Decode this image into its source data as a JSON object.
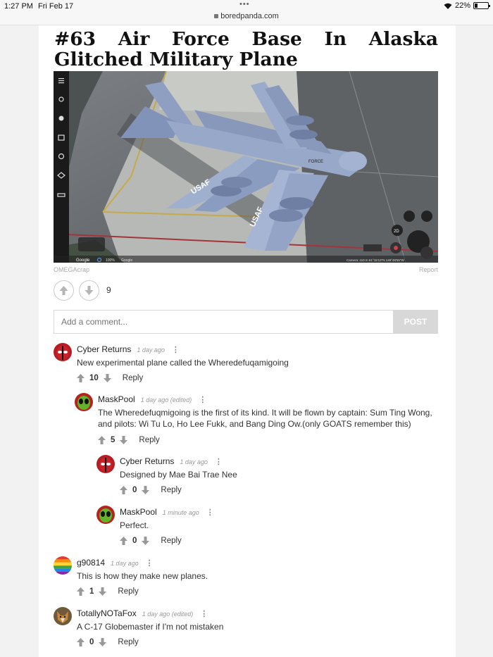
{
  "status_bar": {
    "time": "1:27 PM",
    "date": "Fri Feb 17",
    "url": "boredpanda.com",
    "battery": "22%"
  },
  "post": {
    "title": "#63 Air Force Base In Alaska Glitched Military Plane",
    "credit": "OMEGAcrap",
    "report": "Report",
    "votes": "9"
  },
  "photo": {
    "wing_text_1": "USAF",
    "wing_text_2": "USAF",
    "fuselage_text": "FORCE",
    "badge_2d": "2D",
    "map_google": "Google",
    "map_zoom": "100%",
    "map_google_2": "Google",
    "map_camera": "Camera: 110 m  61°15'13\"N 149°48'55\"W"
  },
  "comment_box": {
    "placeholder": "Add a comment...",
    "post_label": "POST"
  },
  "comments": [
    {
      "name": "Cyber Returns",
      "time": "1 day ago",
      "text": "New experimental plane called the Wheredefuqamigoing",
      "votes": "10",
      "reply": "Reply"
    },
    {
      "name": "MaskPool",
      "time": "1 day ago (edited)",
      "text": "The Wheredefuqmigoing is the first of its kind. It will be flown by captain: Sum Ting Wong, and pilots: Wi Tu Lo, Ho Lee Fukk, and Bang Ding Ow.(only GOATS remember this)",
      "votes": "5",
      "reply": "Reply"
    },
    {
      "name": "Cyber Returns",
      "time": "1 day ago",
      "text": "Designed by Mae Bai Trae Nee",
      "votes": "0",
      "reply": "Reply"
    },
    {
      "name": "MaskPool",
      "time": "1 minute ago",
      "text": "Perfect.",
      "votes": "0",
      "reply": "Reply"
    },
    {
      "name": "g90814",
      "time": "1 day ago",
      "text": "This is how they make new planes.",
      "votes": "1",
      "reply": "Reply"
    },
    {
      "name": "TotallyNOTaFox",
      "time": "1 day ago (edited)",
      "text": "A C-17 Globemaster if I'm not mistaken",
      "votes": "0",
      "reply": "Reply"
    }
  ]
}
